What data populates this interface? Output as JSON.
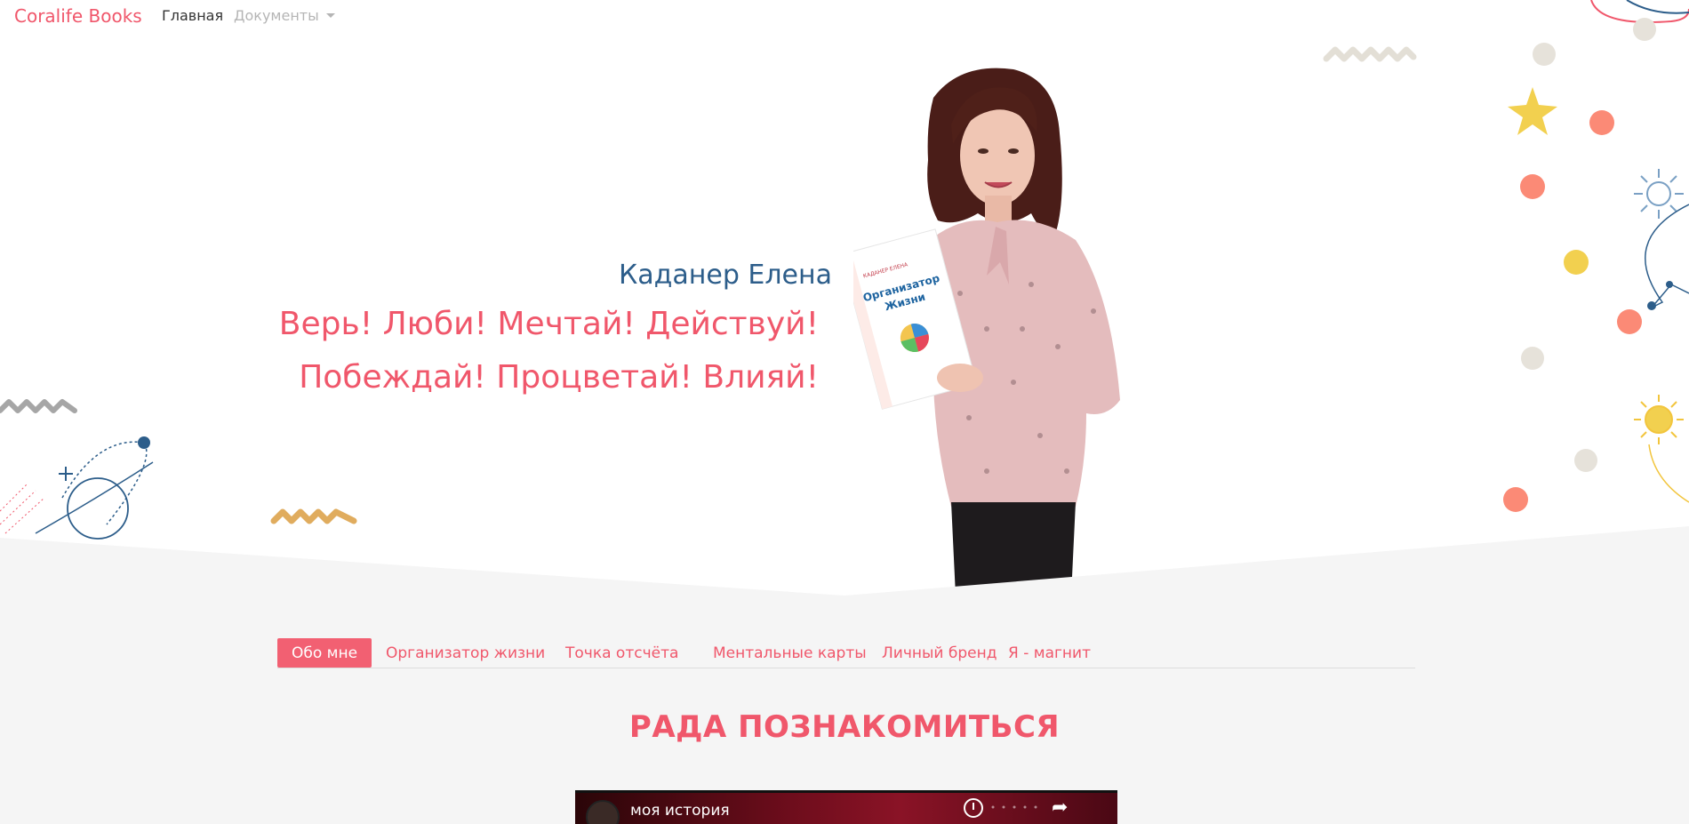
{
  "navbar": {
    "brand": "Coralife Books",
    "home": "Главная",
    "documents": "Документы"
  },
  "hero": {
    "name": "Каданер Елена",
    "slogan_line1": "Верь! Люби! Мечтай! Действуй!",
    "slogan_line2": "Побеждай! Процветай! Влияй!",
    "book": {
      "author": "КАДАНЕР ЕЛЕНА",
      "title_line1": "Организатор",
      "title_line2": "Жизни"
    }
  },
  "tabs": [
    {
      "label": "Обо мне",
      "active": true
    },
    {
      "label": "Организатор жизни",
      "active": false
    },
    {
      "label": "Точка отсчёта",
      "active": false
    },
    {
      "label": "Ментальные карты",
      "active": false
    },
    {
      "label": "Личный бренд",
      "active": false
    },
    {
      "label": "Я - магнит",
      "active": false
    }
  ],
  "section": {
    "title": "РАДА ПОЗНАКОМИТЬСЯ"
  },
  "video": {
    "title": "моя история"
  },
  "colors": {
    "accent": "#f0576b",
    "name": "#2c5d8a",
    "background": "#f5f5f5"
  }
}
